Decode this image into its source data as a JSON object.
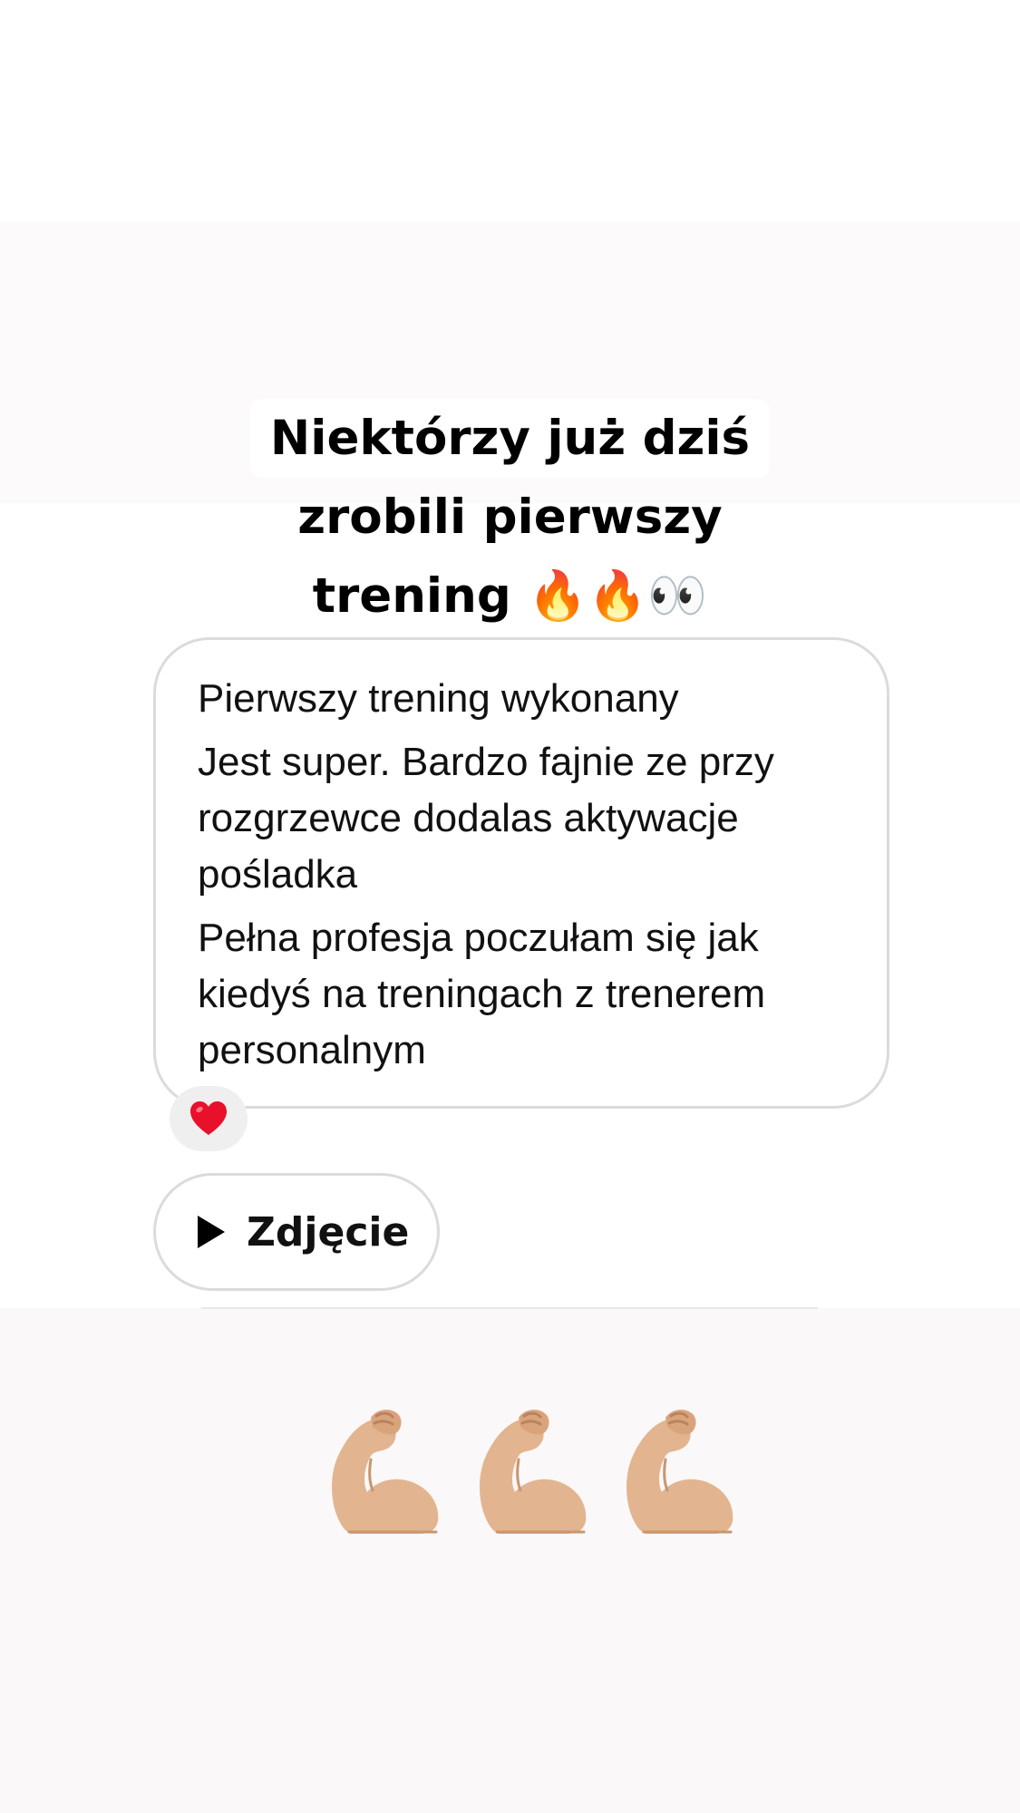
{
  "story": {
    "headline": {
      "line1": "Niektórzy już dziś",
      "line2": "zrobili pierwszy",
      "line3_text": "trening",
      "line3_emojis": "🔥🔥👀"
    }
  },
  "message": {
    "lines": [
      "Pierwszy trening wykonany",
      "Jest super. Bardzo fajnie ze przy rozgrzewce dodalas aktywacje pośladka",
      "Pełna profesja poczułam się jak kiedyś na treningach z trenerem personalnym"
    ],
    "reaction": "❤️"
  },
  "attachment": {
    "label": "Zdjęcie",
    "icon": "play-icon"
  },
  "sticker": {
    "emojis": "💪🏼💪🏼💪🏼",
    "icon": "flexed-biceps-icon",
    "count": 3
  },
  "colors": {
    "bubble_border": "#dbdbdb",
    "reaction_bg": "#efefef",
    "heart": "#e8102a",
    "skin": "#e2b48f"
  }
}
